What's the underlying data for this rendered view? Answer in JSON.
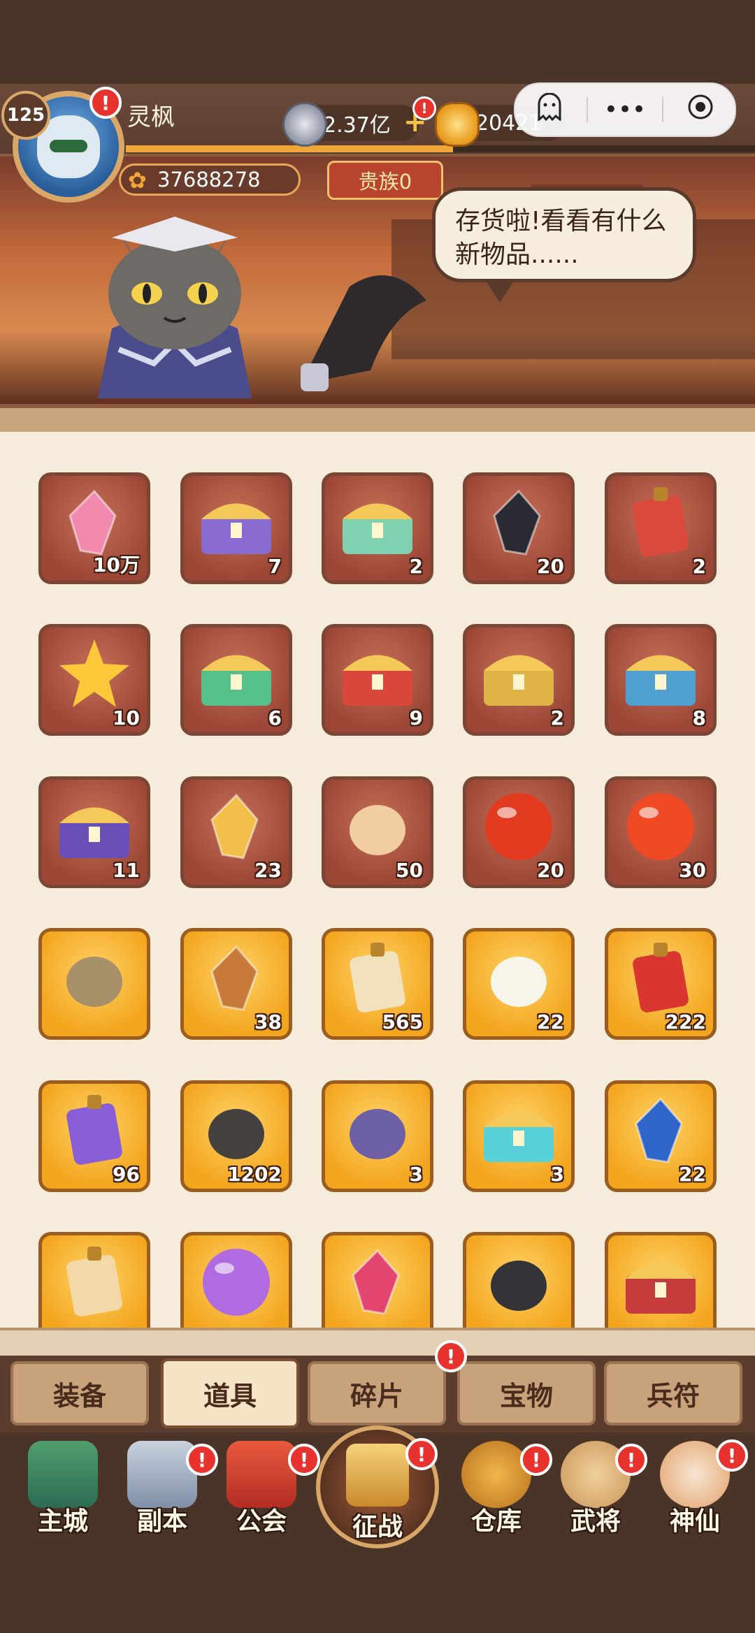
{
  "player": {
    "level": "125",
    "name": "灵枫",
    "paw_points": "37688278",
    "noble": "贵族0",
    "exp_progress": 0.52
  },
  "resources": {
    "silver": "2.37亿",
    "gold": "20421"
  },
  "capsule": {
    "menu": "•••",
    "alt_icon": "ghost-icon",
    "close_icon": "record-icon"
  },
  "banner": {
    "speech": "存货啦!看看有什么新物品......"
  },
  "items": [
    {
      "count": "10万",
      "style": "red",
      "icon": "pink-crystal-icon"
    },
    {
      "count": "7",
      "style": "red",
      "icon": "purple-chest-icon"
    },
    {
      "count": "2",
      "style": "red",
      "icon": "rainbow-chest-icon"
    },
    {
      "count": "20",
      "style": "red",
      "icon": "black-crystal-icon"
    },
    {
      "count": "2",
      "style": "red",
      "icon": "mystery-coin-icon"
    },
    {
      "count": "10",
      "style": "red",
      "icon": "gold-star-icon"
    },
    {
      "count": "6",
      "style": "red",
      "icon": "green-chest-icon"
    },
    {
      "count": "9",
      "style": "red",
      "icon": "red-chest-icon"
    },
    {
      "count": "2",
      "style": "red",
      "icon": "treasure-chest-icon"
    },
    {
      "count": "8",
      "style": "red",
      "icon": "blue-treasure-chest-icon"
    },
    {
      "count": "11",
      "style": "red",
      "icon": "purple-treasure-chest-icon"
    },
    {
      "count": "23",
      "style": "red",
      "icon": "gold-ore-icon"
    },
    {
      "count": "50",
      "style": "red",
      "icon": "general-portrait-icon"
    },
    {
      "count": "20",
      "style": "red",
      "icon": "fire-orb-icon"
    },
    {
      "count": "30",
      "style": "red",
      "icon": "red-orb-icon"
    },
    {
      "count": "",
      "style": "gold",
      "icon": "chameleon-statue-icon"
    },
    {
      "count": "38",
      "style": "gold",
      "icon": "rune-stone-icon"
    },
    {
      "count": "565",
      "style": "gold",
      "icon": "scroll-icon"
    },
    {
      "count": "22",
      "style": "gold",
      "icon": "lotus-icon"
    },
    {
      "count": "222",
      "style": "gold",
      "icon": "red-token-icon"
    },
    {
      "count": "96",
      "style": "gold",
      "icon": "purple-token-icon"
    },
    {
      "count": "1202",
      "style": "gold",
      "icon": "iron-ore-icon"
    },
    {
      "count": "3",
      "style": "gold",
      "icon": "silver-bag-icon"
    },
    {
      "count": "3",
      "style": "gold",
      "icon": "pearl-box-icon"
    },
    {
      "count": "22",
      "style": "gold",
      "icon": "blue-gem-icon"
    },
    {
      "count": "",
      "style": "gold",
      "icon": "mystery-dice-icon"
    },
    {
      "count": "",
      "style": "gold",
      "icon": "moon-icon"
    },
    {
      "count": "",
      "style": "gold",
      "icon": "ruby-icon"
    },
    {
      "count": "",
      "style": "gold",
      "icon": "whip-icon"
    },
    {
      "count": "",
      "style": "gold",
      "icon": "crimson-chest-icon"
    }
  ],
  "tabs": [
    "装备",
    "道具",
    "碎片",
    "宝物",
    "兵符"
  ],
  "active_tab": 1,
  "nav": [
    "主城",
    "副本",
    "公会",
    "征战",
    "仓库",
    "武将",
    "神仙"
  ],
  "colors": {
    "accent": "#f3a51e",
    "alert": "#e8322d",
    "panel": "#f6ecdc"
  }
}
